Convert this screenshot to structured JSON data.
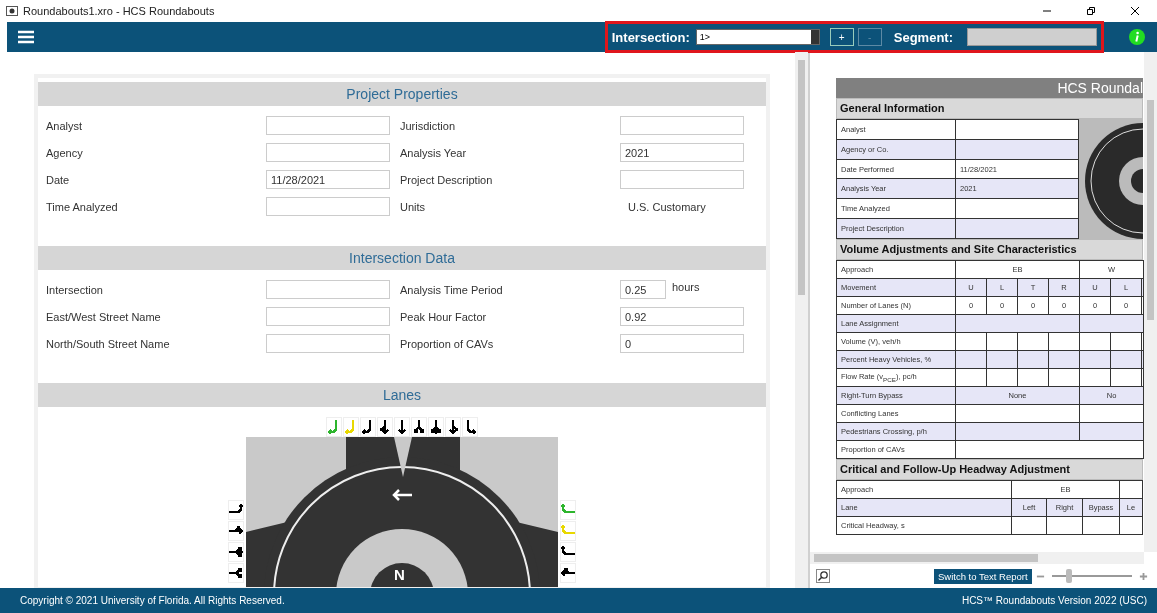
{
  "window": {
    "title": "Roundabouts1.xro - HCS Roundabouts"
  },
  "toolbar": {
    "highlighted": true,
    "intersection_label": "Intersection:",
    "intersection_value": "1>",
    "buttons": [
      {
        "label": "+",
        "disabled": false
      },
      {
        "label": "-",
        "disabled": true
      }
    ],
    "segment_label": "Segment:",
    "segment_disabled": true
  },
  "project_properties": {
    "title": "Project Properties",
    "rows": [
      {
        "left": {
          "label": "Analyst",
          "kind": "field"
        },
        "right": {
          "label": "Jurisdiction",
          "kind": "field"
        }
      },
      {
        "left": {
          "label": "Agency",
          "kind": "field"
        },
        "right": {
          "label": "Analysis Year",
          "kind": "field",
          "value": "2021"
        }
      },
      {
        "left": {
          "label": "Date",
          "kind": "field",
          "value": "11/28/2021"
        },
        "right": {
          "label": "Project Description",
          "kind": "field"
        }
      },
      {
        "left": {
          "label": "Time Analyzed",
          "kind": "field"
        },
        "right": {
          "label": "Units",
          "kind": "text",
          "value": "U.S. Customary"
        }
      }
    ]
  },
  "intersection_data": {
    "title": "Intersection Data",
    "rows": [
      {
        "left": {
          "label": "Intersection",
          "kind": "field"
        },
        "right": {
          "label": "Analysis Time Period",
          "kind": "short_field",
          "value": "0.25",
          "unit": "hours"
        }
      },
      {
        "left": {
          "label": "East/West Street Name",
          "kind": "field"
        },
        "right": {
          "label": "Peak Hour Factor",
          "kind": "field",
          "value": "0.92"
        }
      },
      {
        "left": {
          "label": "North/South Street Name",
          "kind": "field"
        },
        "right": {
          "label": "Proportion of CAVs",
          "kind": "field",
          "value": "0"
        }
      }
    ]
  },
  "lanes": {
    "title": "Lanes",
    "compass": "N",
    "north_icons": [
      {
        "color": "#2db52d"
      },
      {
        "color": "#e8d800"
      },
      {
        "color": "#000000"
      },
      {
        "color": "#000000"
      },
      {
        "color": "#000000"
      },
      {
        "color": "#000000"
      },
      {
        "color": "#000000"
      },
      {
        "color": "#000000"
      },
      {
        "color": "#000000"
      }
    ],
    "west_icons": [
      {
        "color": "#000000"
      },
      {
        "color": "#000000"
      },
      {
        "color": "#000000"
      },
      {
        "color": "#000000"
      }
    ],
    "east_icons": [
      {
        "color": "#2db52d"
      },
      {
        "color": "#e8d800"
      },
      {
        "color": "#000000"
      },
      {
        "color": "#000000"
      }
    ]
  },
  "report": {
    "title": "HCS Roundal",
    "general": {
      "title": "General Information",
      "rows": [
        {
          "label": "Analyst"
        },
        {
          "label": "Agency or Co."
        },
        {
          "label": "Date Performed",
          "value": "11/28/2021"
        },
        {
          "label": "Analysis Year",
          "value": "2021"
        },
        {
          "label": "Time Analyzed"
        },
        {
          "label": "Project Description"
        }
      ]
    },
    "volume": {
      "title": "Volume Adjustments and Site Characteristics",
      "rows": [
        {
          "label": "Approach",
          "kind": "groups",
          "cells": [
            {
              "text": "EB"
            },
            {
              "text": "W"
            }
          ]
        },
        {
          "label": "Movement",
          "kind": "cells",
          "cells": [
            {
              "text": "U"
            },
            {
              "text": "L"
            },
            {
              "text": "T"
            },
            {
              "text": "R"
            },
            {
              "text": "U"
            },
            {
              "text": "L"
            }
          ]
        },
        {
          "label": "Number of Lanes (N)",
          "kind": "cells",
          "cells": [
            {
              "text": "0"
            },
            {
              "text": "0"
            },
            {
              "text": "0"
            },
            {
              "text": "0"
            },
            {
              "text": "0"
            },
            {
              "text": "0"
            }
          ]
        },
        {
          "label": "Lane Assignment",
          "kind": "blank_groups"
        },
        {
          "label": "Volume (V), veh/h",
          "kind": "blank_cells"
        },
        {
          "label": "Percent Heavy Vehicles, %",
          "kind": "blank_cells"
        },
        {
          "label": "Flow Rate (v$_{PCE}$), pc/h",
          "kind": "blank_cells"
        },
        {
          "label": "Right-Turn Bypass",
          "kind": "groups",
          "cells": [
            {
              "text": "None"
            },
            {
              "text": "No"
            }
          ]
        },
        {
          "label": "Conflicting Lanes",
          "kind": "blank_groups"
        },
        {
          "label": "Pedestrians Crossing, p/h",
          "kind": "blank_groups"
        },
        {
          "label": "Proportion of CAVs",
          "kind": "blank_full"
        }
      ]
    },
    "headway": {
      "title": "Critical and Follow-Up Headway Adjustment",
      "rows": [
        {
          "label": "Approach",
          "kind": "groups",
          "cells": [
            {
              "text": "EB"
            }
          ]
        },
        {
          "label": "Lane",
          "kind": "cells",
          "cells": [
            {
              "text": "Left"
            },
            {
              "text": "Right"
            },
            {
              "text": "Bypass"
            },
            {
              "text": "Le"
            }
          ]
        },
        {
          "label": "Critical Headway, s",
          "kind": "blank_cells"
        }
      ]
    }
  },
  "report_toolbar": {
    "button": "Switch to Text Report",
    "zoom": {
      "level": 0.2
    }
  },
  "footer": {
    "copyright": "Copyright © 2021 University of Florida. All Rights Reserved.",
    "version": "HCS™ Roundabouts Version 2022 (USC)"
  }
}
